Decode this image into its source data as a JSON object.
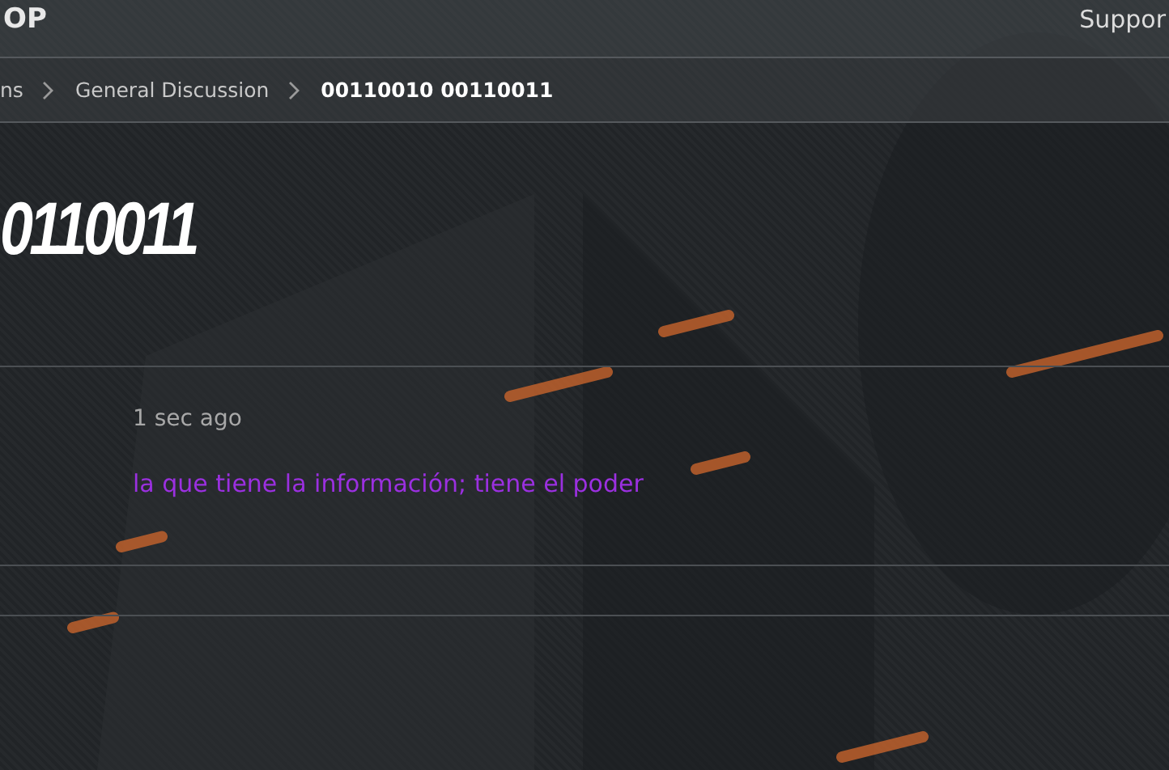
{
  "header": {
    "brand": "OP",
    "link": "Suppor"
  },
  "breadcrumbs": [
    {
      "label": "ns",
      "current": false
    },
    {
      "label": "General Discussion",
      "current": false
    },
    {
      "label": "00110010 00110011",
      "current": true
    }
  ],
  "title": "0110011",
  "post": {
    "time": "1 sec ago",
    "message": "la que tiene la información; tiene el poder",
    "color": "#9b30e0"
  }
}
